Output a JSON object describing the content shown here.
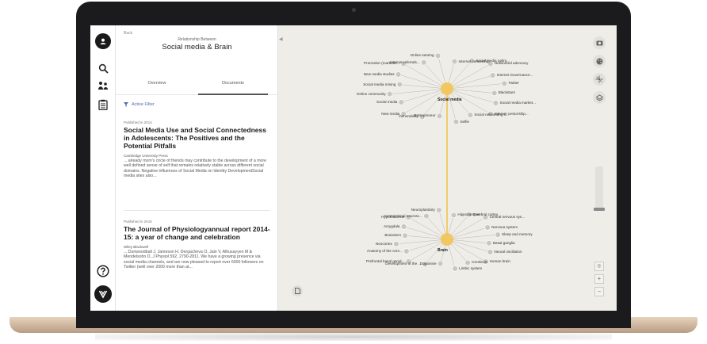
{
  "nav": {
    "back": "Back"
  },
  "header": {
    "relationship_between": "Relationship Between",
    "title": "Social media & Brain"
  },
  "tabs": [
    {
      "label": "Overview",
      "active": false
    },
    {
      "label": "Documents",
      "active": true
    }
  ],
  "filter": {
    "label": "Active Filter"
  },
  "documents": [
    {
      "published": "Published in 2014",
      "title": "Social Media Use and Social Connectedness in Adolescents: The Positives and the Potential Pitfalls",
      "publisher": "Cambridge University Press",
      "excerpt": "... already mom's circle of friends may contribute to the development of a more well defined sense of self that remains relatively stable across different social domains. Negative influences of Social Media on Identity DevelopmentSocial media sites also..."
    },
    {
      "published": "Published in 2015",
      "title": "The Journal of Physiologyannual report 2014-15: a year of change and celebration",
      "publisher": "Wiley Blackwell",
      "excerpt": "... Dunwoodball J, Jameson H, Dergacheva O, Jain V, Alhusayyen M & Mendelsohn D, J Physiol 592, 2790-2811. We have a growing presence via social media channels, and are now pleased to report over 6000 followers on Twitter (well over 2000 more than at..."
    }
  ],
  "graph": {
    "hubs": [
      {
        "id": "social-media",
        "label": "Social media",
        "color": "#f1c761",
        "neighbors": [
          "Entrepreneur",
          "Vulnerability",
          "New media",
          "Social media",
          "Online community",
          "Social media mining",
          "New media studies",
          "Promotion (marketin...",
          "Internet referrals...",
          "Online tutoring",
          "Internet censorship",
          "Social media optim...",
          "Networked advocacy",
          "Internet Governance...",
          "Twitter",
          "Blackstars",
          "Social media market...",
          "Internet censorship...",
          "Social networking s...",
          "Selfie"
        ]
      },
      {
        "id": "brain",
        "label": "Brain",
        "color": "#f1c761",
        "neighbors": [
          "Hippocampus",
          "Cerebral cortex",
          "Central nervous sys...",
          "Nervous system",
          "Sleep and memory",
          "Basal ganglia",
          "Neural oscillation",
          "Human brain",
          "Cerebrum",
          "Limbic system",
          "Dopamine",
          "Development of the ...",
          "Prefrontal basal gangl...",
          "Anatomy of the cere...",
          "Neocortex",
          "Brainstem",
          "Amygdala",
          "Hypothalamus",
          "Connectional neurosc...",
          "Neuroplasticity"
        ]
      }
    ],
    "edge_color": "#f0c44a"
  },
  "toolbar": {
    "icons": [
      "camera-icon",
      "palette-icon",
      "layout-icon",
      "layers-icon"
    ],
    "zoom_in": "+",
    "zoom_out": "−"
  }
}
